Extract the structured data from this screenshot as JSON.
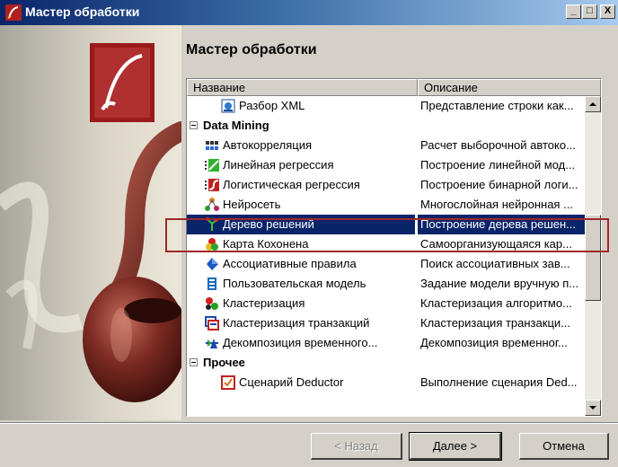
{
  "window": {
    "title": "Мастер обработки",
    "controls": {
      "minimize": "_",
      "maximize": "□",
      "close": "X"
    }
  },
  "heading": "Мастер обработки",
  "list": {
    "columns": [
      "Название",
      "Описание"
    ],
    "rows": [
      {
        "type": "item",
        "icon": "xml-parse-icon",
        "name": "Разбор XML",
        "description": "Представление строки как..."
      },
      {
        "type": "group",
        "name": "Data Mining"
      },
      {
        "type": "item",
        "icon": "autocorrelation-icon",
        "name": "Автокорреляция",
        "description": "Расчет выборочной автоко..."
      },
      {
        "type": "item",
        "icon": "linear-regression-icon",
        "name": "Линейная регрессия",
        "description": "Построение линейной мод..."
      },
      {
        "type": "item",
        "icon": "logistic-regression-icon",
        "name": "Логистическая регрессия",
        "description": "Построение бинарной логи..."
      },
      {
        "type": "item",
        "icon": "neural-network-icon",
        "name": "Нейросеть",
        "description": "Многослойная нейронная ..."
      },
      {
        "type": "item",
        "icon": "decision-tree-icon",
        "name": "Дерево решений",
        "description": "Построение дерева решен...",
        "selected": true
      },
      {
        "type": "item",
        "icon": "kohonen-map-icon",
        "name": "Карта Кохонена",
        "description": "Самоорганизующаяся кар..."
      },
      {
        "type": "item",
        "icon": "association-rules-icon",
        "name": "Ассоциативные правила",
        "description": "Поиск ассоциативных зав..."
      },
      {
        "type": "item",
        "icon": "user-model-icon",
        "name": "Пользовательская модель",
        "description": "Задание модели вручную п..."
      },
      {
        "type": "item",
        "icon": "clustering-icon",
        "name": "Кластеризация",
        "description": "Кластеризация алгоритмо..."
      },
      {
        "type": "item",
        "icon": "transaction-clustering-icon",
        "name": "Кластеризация транзакций",
        "description": "Кластеризация транзакци..."
      },
      {
        "type": "item",
        "icon": "time-decomposition-icon",
        "name": "Декомпозиция временного...",
        "description": "Декомпозиция временног..."
      },
      {
        "type": "group",
        "name": "Прочее"
      },
      {
        "type": "item",
        "icon": "deductor-script-icon",
        "name": "Сценарий Deductor",
        "description": "Выполнение сценария Ded..."
      }
    ]
  },
  "buttons": {
    "back": "< Назад",
    "next": "Далее >",
    "cancel": "Отмена"
  },
  "colors": {
    "selection": "#0a246a",
    "highlight_frame": "#a02828",
    "titlebar": "#0a246a",
    "face": "#d4d0c8"
  }
}
